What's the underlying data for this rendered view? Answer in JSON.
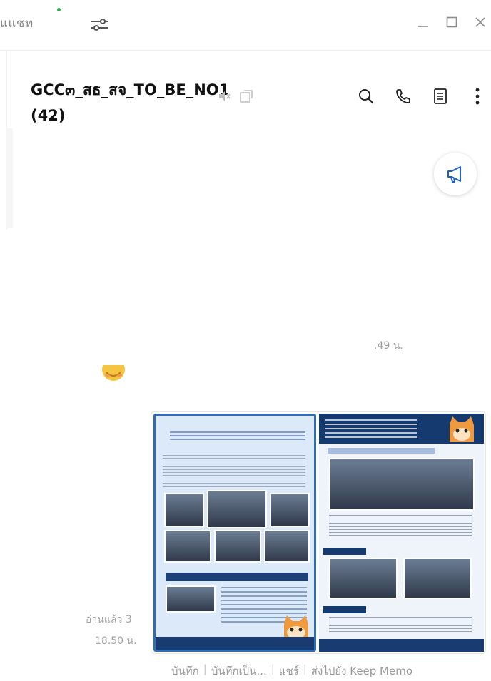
{
  "window": {
    "left_title": "แแชท",
    "presence_color": "#22b34a"
  },
  "chat": {
    "title": "GCC๓_สธ_สจ_TO_BE_NO1 (42)",
    "accent_color": "#1e62c8"
  },
  "header_icons": [
    "search-icon",
    "phone-icon",
    "notes-icon",
    "more-icon"
  ],
  "messages": {
    "time_partial": ".49 น.",
    "read_status": "อ่านแล้ว 3",
    "time_image": "18.50 น."
  },
  "actions": {
    "save": "บันทึก",
    "save_as": "บันทึกเป็น...",
    "share": "แชร์",
    "keep_memo": "ส่งไปยัง Keep Memo",
    "separator": "|"
  }
}
